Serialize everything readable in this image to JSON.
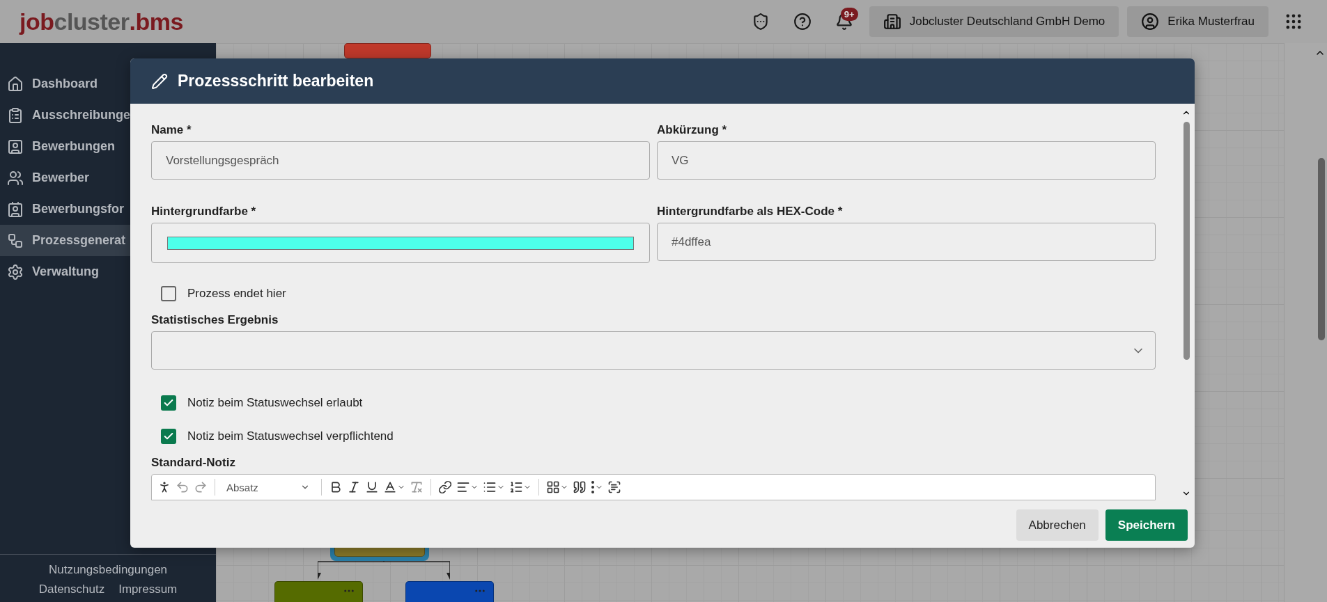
{
  "header": {
    "logo": {
      "part_1": "job",
      "part_2": "cluster",
      "part_3": ".bms"
    },
    "notification_count": "9+",
    "company": "Jobcluster Deutschland GmbH Demo",
    "user": "Erika Musterfrau"
  },
  "sidebar": {
    "items": [
      {
        "label": "Dashboard",
        "selected": false
      },
      {
        "label": "Ausschreibunge",
        "selected": false
      },
      {
        "label": "Bewerbungen",
        "selected": false
      },
      {
        "label": "Bewerber",
        "selected": false
      },
      {
        "label": "Bewerbungsfor",
        "selected": false
      },
      {
        "label": "Prozessgenerat",
        "selected": true
      },
      {
        "label": "Verwaltung",
        "selected": false
      }
    ],
    "footer_links": [
      "Nutzungsbedingungen",
      "Datenschutz",
      "Impressum"
    ]
  },
  "canvas": {
    "nodes": [
      {
        "color": "#c0392b",
        "kind": "plain"
      },
      {
        "color": "#8a7a2a",
        "kind": "highlighted"
      },
      {
        "color": "#556b00",
        "kind": "menu"
      },
      {
        "color": "#0a47b0",
        "kind": "menu"
      }
    ]
  },
  "dialog": {
    "title": "Prozessschritt bearbeiten",
    "name": {
      "label": "Name *",
      "value": "Vorstellungsgespräch"
    },
    "abbreviation": {
      "label": "Abkürzung *",
      "value": "VG"
    },
    "background_color": {
      "label": "Hintergrundfarbe *"
    },
    "hex_code": {
      "label": "Hintergrundfarbe als HEX-Code *",
      "value": "#4dffea"
    },
    "ends_here": {
      "label": "Prozess endet hier",
      "checked": false
    },
    "statistical_result": {
      "label": "Statistisches Ergebnis"
    },
    "note_options": [
      {
        "label": "Notiz beim Statuswechsel erlaubt",
        "checked": true
      },
      {
        "label": "Notiz beim Statuswechsel verpflichtend",
        "checked": true
      }
    ],
    "default_note": {
      "label": "Standard-Notiz",
      "block_format": "Absatz"
    },
    "buttons": [
      {
        "label": "Abbrechen",
        "kind": "secondary"
      },
      {
        "label": "Speichern",
        "kind": "primary"
      }
    ]
  }
}
